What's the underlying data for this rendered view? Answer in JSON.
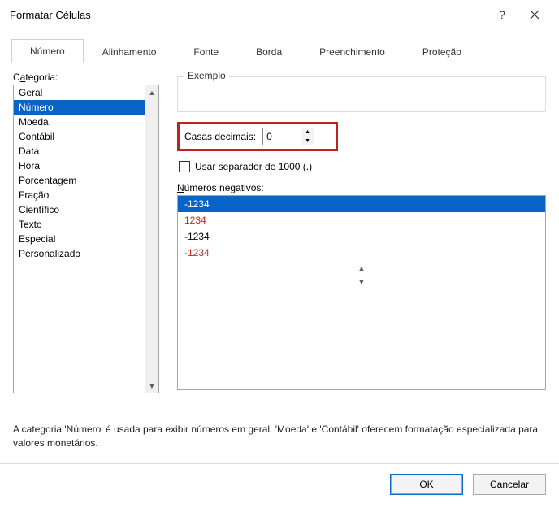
{
  "title": "Formatar Células",
  "tabs": [
    "Número",
    "Alinhamento",
    "Fonte",
    "Borda",
    "Preenchimento",
    "Proteção"
  ],
  "active_tab_index": 0,
  "category": {
    "label_pre": "C",
    "label_ul": "a",
    "label_post": "tegoria:",
    "items": [
      "Geral",
      "Número",
      "Moeda",
      "Contábil",
      "Data",
      "Hora",
      "Porcentagem",
      "Fração",
      "Científico",
      "Texto",
      "Especial",
      "Personalizado"
    ],
    "selected_index": 1
  },
  "example": {
    "label": "Exemplo",
    "value": ""
  },
  "decimals": {
    "label_pre": "Casas ",
    "label_ul": "d",
    "label_post": "ecimais:",
    "value": "0"
  },
  "thousands": {
    "label_pre": "",
    "label_ul": "U",
    "label_post": "sar separador de 1000 (.)",
    "checked": false
  },
  "negatives": {
    "label_pre": "",
    "label_ul": "N",
    "label_post": "úmeros negativos:",
    "items": [
      {
        "text": "-1234",
        "red": false,
        "selected": true
      },
      {
        "text": "1234",
        "red": true,
        "selected": false
      },
      {
        "text": "-1234",
        "red": false,
        "selected": false
      },
      {
        "text": "-1234",
        "red": true,
        "selected": false
      }
    ]
  },
  "description": "A categoria 'Número' é usada para exibir números em geral. 'Moeda' e 'Contábil' oferecem formatação especializada para valores monetários.",
  "buttons": {
    "ok": "OK",
    "cancel": "Cancelar"
  }
}
